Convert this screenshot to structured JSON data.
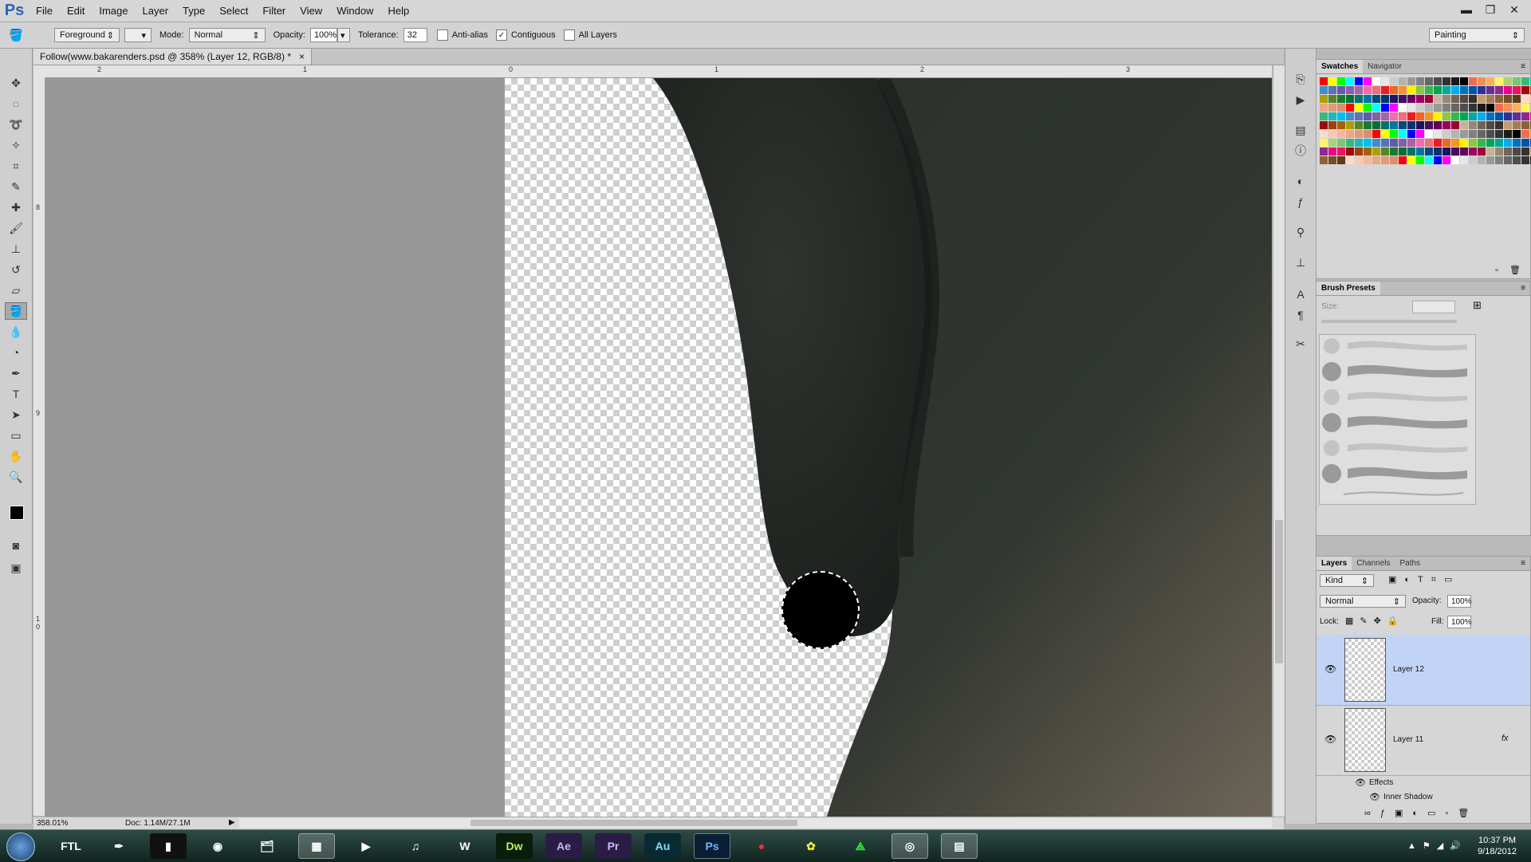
{
  "app": {
    "logo": "Ps"
  },
  "menu": [
    "File",
    "Edit",
    "Image",
    "Layer",
    "Type",
    "Select",
    "Filter",
    "View",
    "Window",
    "Help"
  ],
  "window_controls": [
    "▬",
    "❐",
    "✕"
  ],
  "options": {
    "fill_source": "Foreground",
    "mode_label": "Mode:",
    "mode_value": "Normal",
    "opacity_label": "Opacity:",
    "opacity_value": "100%",
    "tolerance_label": "Tolerance:",
    "tolerance_value": "32",
    "anti_alias_label": "Anti-alias",
    "contiguous_label": "Contiguous",
    "all_layers_label": "All Layers",
    "workspace": "Painting"
  },
  "document": {
    "tab_title": "Follow(www.bakarenders.psd @ 358% (Layer 12, RGB/8) *",
    "close": "×"
  },
  "ruler": {
    "top_ticks": [
      "2",
      "1",
      "0",
      "1",
      "2",
      "3"
    ],
    "left_ticks": [
      "8",
      "9",
      "1",
      "0"
    ]
  },
  "status": {
    "zoom": "358.01%",
    "doc": "Doc: 1.14M/27.1M"
  },
  "swatches_panel": {
    "tabs": [
      "Swatches",
      "Navigator"
    ]
  },
  "brush_panel": {
    "title": "Brush Presets",
    "size_label": "Size:"
  },
  "layers_panel": {
    "tabs": [
      "Layers",
      "Channels",
      "Paths"
    ],
    "kind_label": "Kind",
    "blend_mode": "Normal",
    "opacity_label": "Opacity:",
    "opacity_value": "100%",
    "lock_label": "Lock:",
    "fill_label": "Fill:",
    "fill_value": "100%",
    "layers": [
      {
        "name": "Layer 12",
        "selected": true
      },
      {
        "name": "Layer 11",
        "fx": "fx"
      }
    ],
    "effects_label": "Effects",
    "effect_item": "Inner Shadow"
  },
  "taskbar": {
    "apps": [
      "FTL",
      "Dw",
      "Ae",
      "Pr",
      "Au",
      "Ps"
    ],
    "time": "10:37 PM",
    "date": "9/18/2012"
  },
  "colors": {
    "selection_blue": "#c2d4f5",
    "taskbar_dark": "#10231f",
    "ps_blue": "#2b62b7"
  }
}
